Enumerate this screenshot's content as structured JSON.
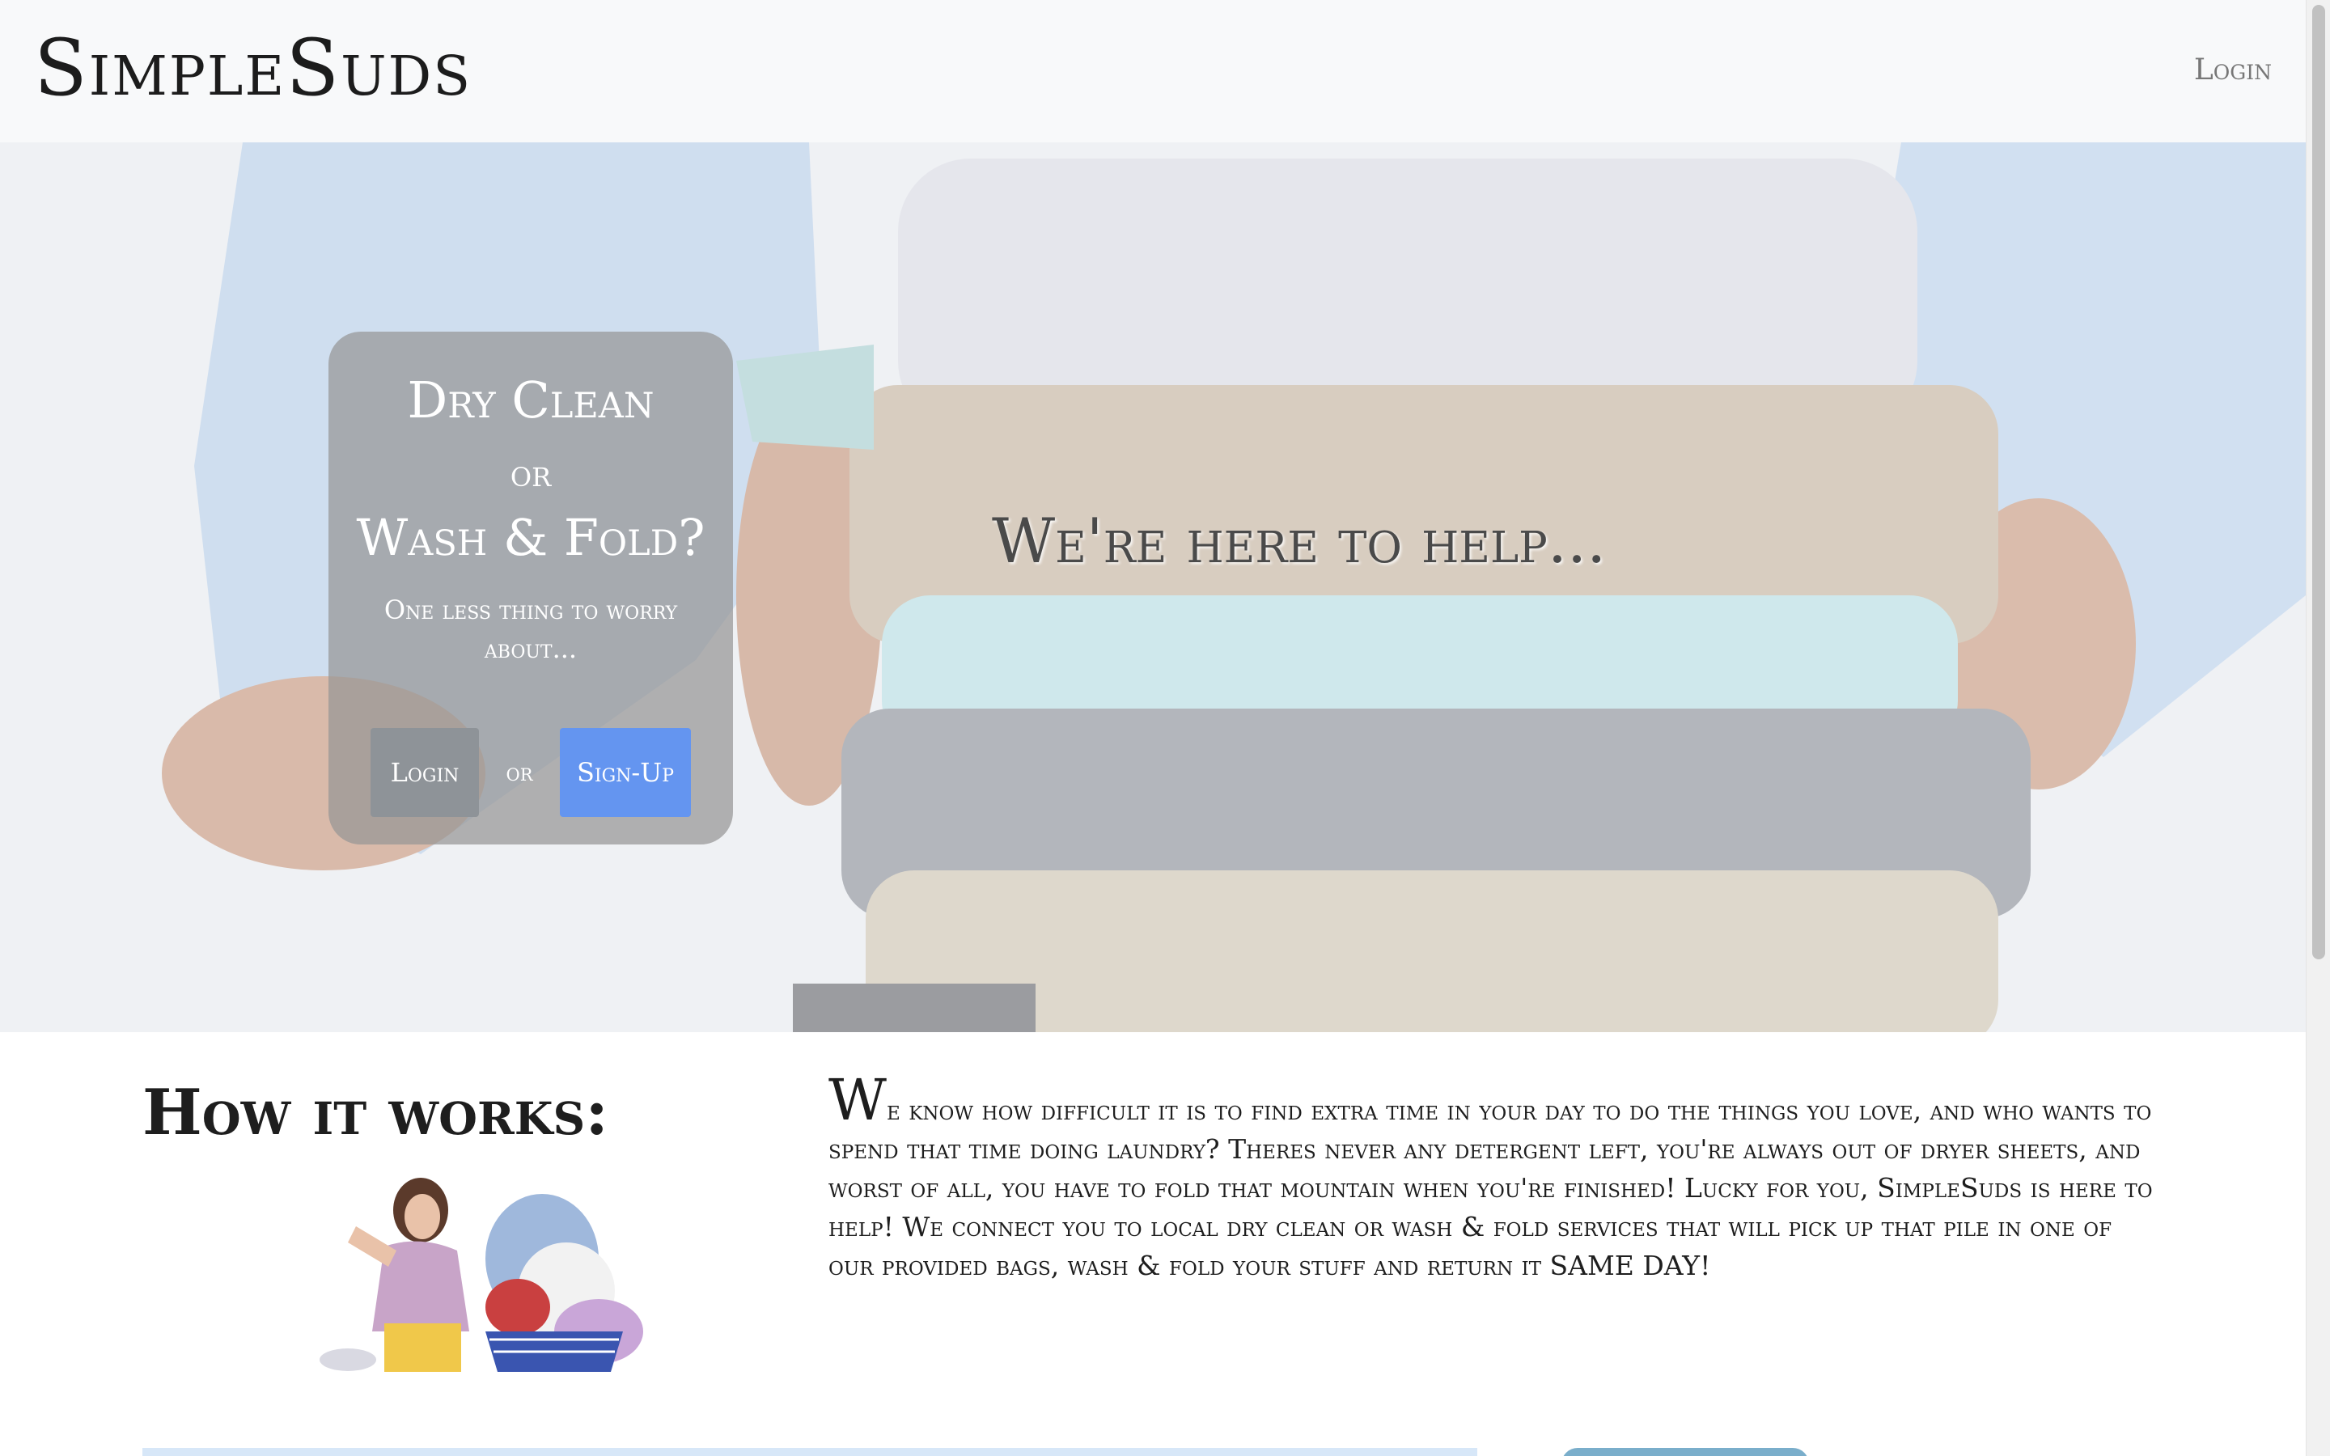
{
  "navbar": {
    "brand": "SimpleSuds",
    "login_label": "Login"
  },
  "hero": {
    "card": {
      "line1": "Dry Clean",
      "or_word": "or",
      "line2": "Wash & Fold?",
      "subtitle": "One less thing to worry about...",
      "login_button": "Login",
      "between_buttons": "or",
      "signup_button": "Sign-Up"
    },
    "tagline": "We're here to help..."
  },
  "how_it_works": {
    "title": "How it works:",
    "dropcap": "W",
    "body_part1": "e know how difficult it is to find extra time in your day to do the things you love, and who wants to spend that time doing laundry? Theres never any detergent left, you're always out of dryer sheets, and worst of all, you have to fold that mountain when you're finished! Lucky for you, SimpleSuds is here to help! We connect you to local dry clean or wash & fold services that will pick up that pile in one of our provided bags, wash & fold your stuff and return it ",
    "body_emphasis": "SAME DAY",
    "body_end": "!"
  },
  "colors": {
    "navbar_bg": "#f8f9fa",
    "card_bg": "rgba(150,150,150,0.72)",
    "login_button": "#8e9398",
    "signup_button": "#6495f0"
  },
  "icons": {
    "hero_image": "folded-clothes-photo",
    "how_image": "woman-with-laundry-basket-illustration"
  }
}
